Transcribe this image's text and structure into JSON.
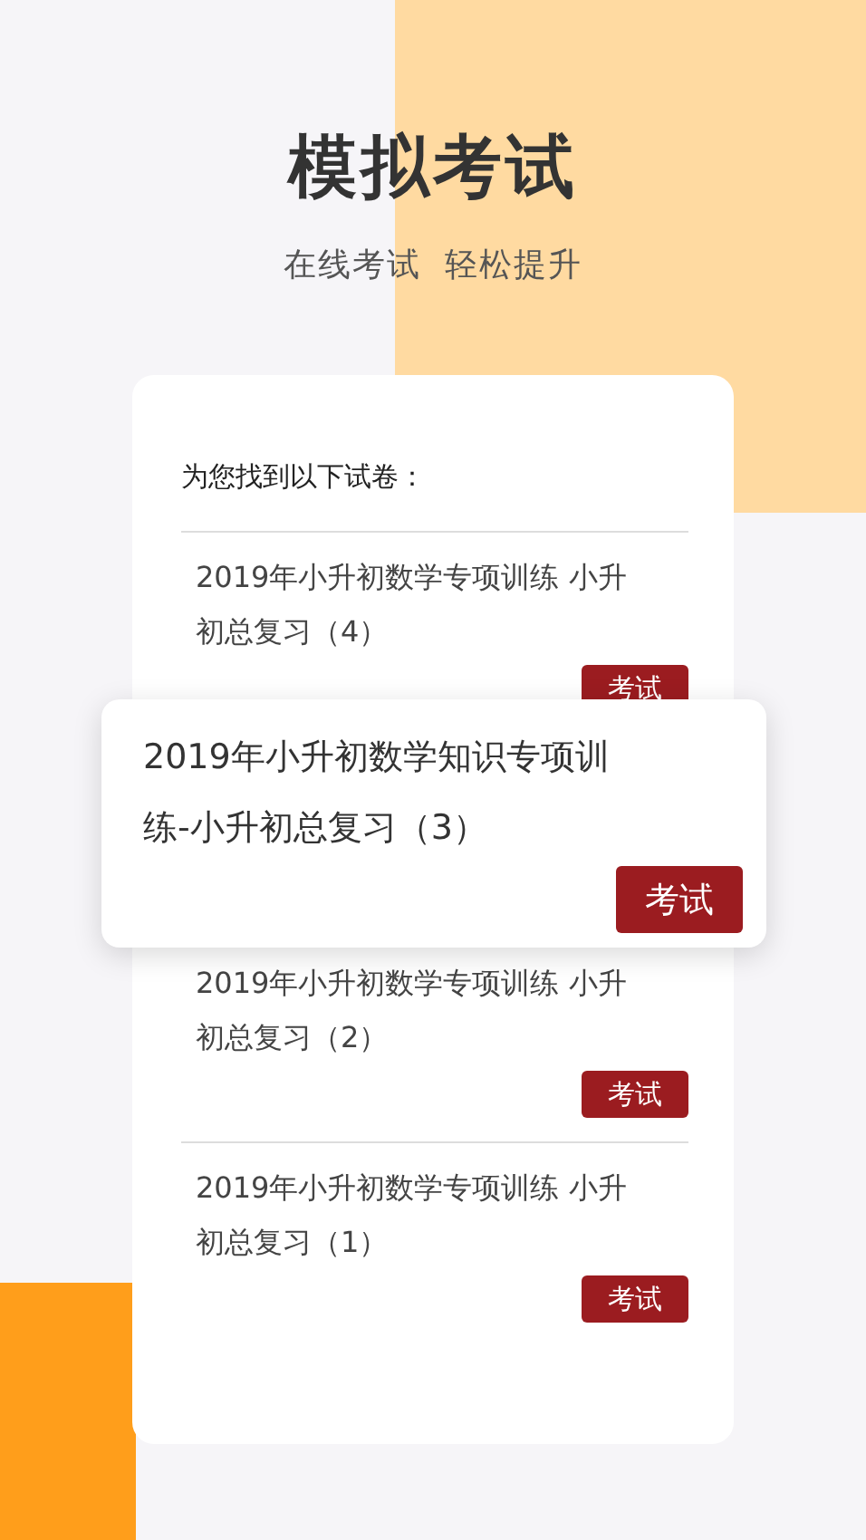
{
  "title": "模拟考试",
  "subtitle": "在线考试  轻松提升",
  "card": {
    "heading": "为您找到以下试卷：",
    "papers": [
      {
        "kind": "item",
        "title": "2019年小升初数学专项训练 小升初总复习（4）",
        "button": "考试"
      },
      {
        "kind": "popup",
        "title": "2019年小升初数学知识专项训练-小升初总复习（3）",
        "button": "考试"
      },
      {
        "kind": "item",
        "title": "2019年小升初数学专项训练 小升初总复习（2）",
        "button": "考试"
      },
      {
        "kind": "item",
        "title": "2019年小升初数学专项训练 小升初总复习（1）",
        "button": "考试"
      }
    ]
  }
}
